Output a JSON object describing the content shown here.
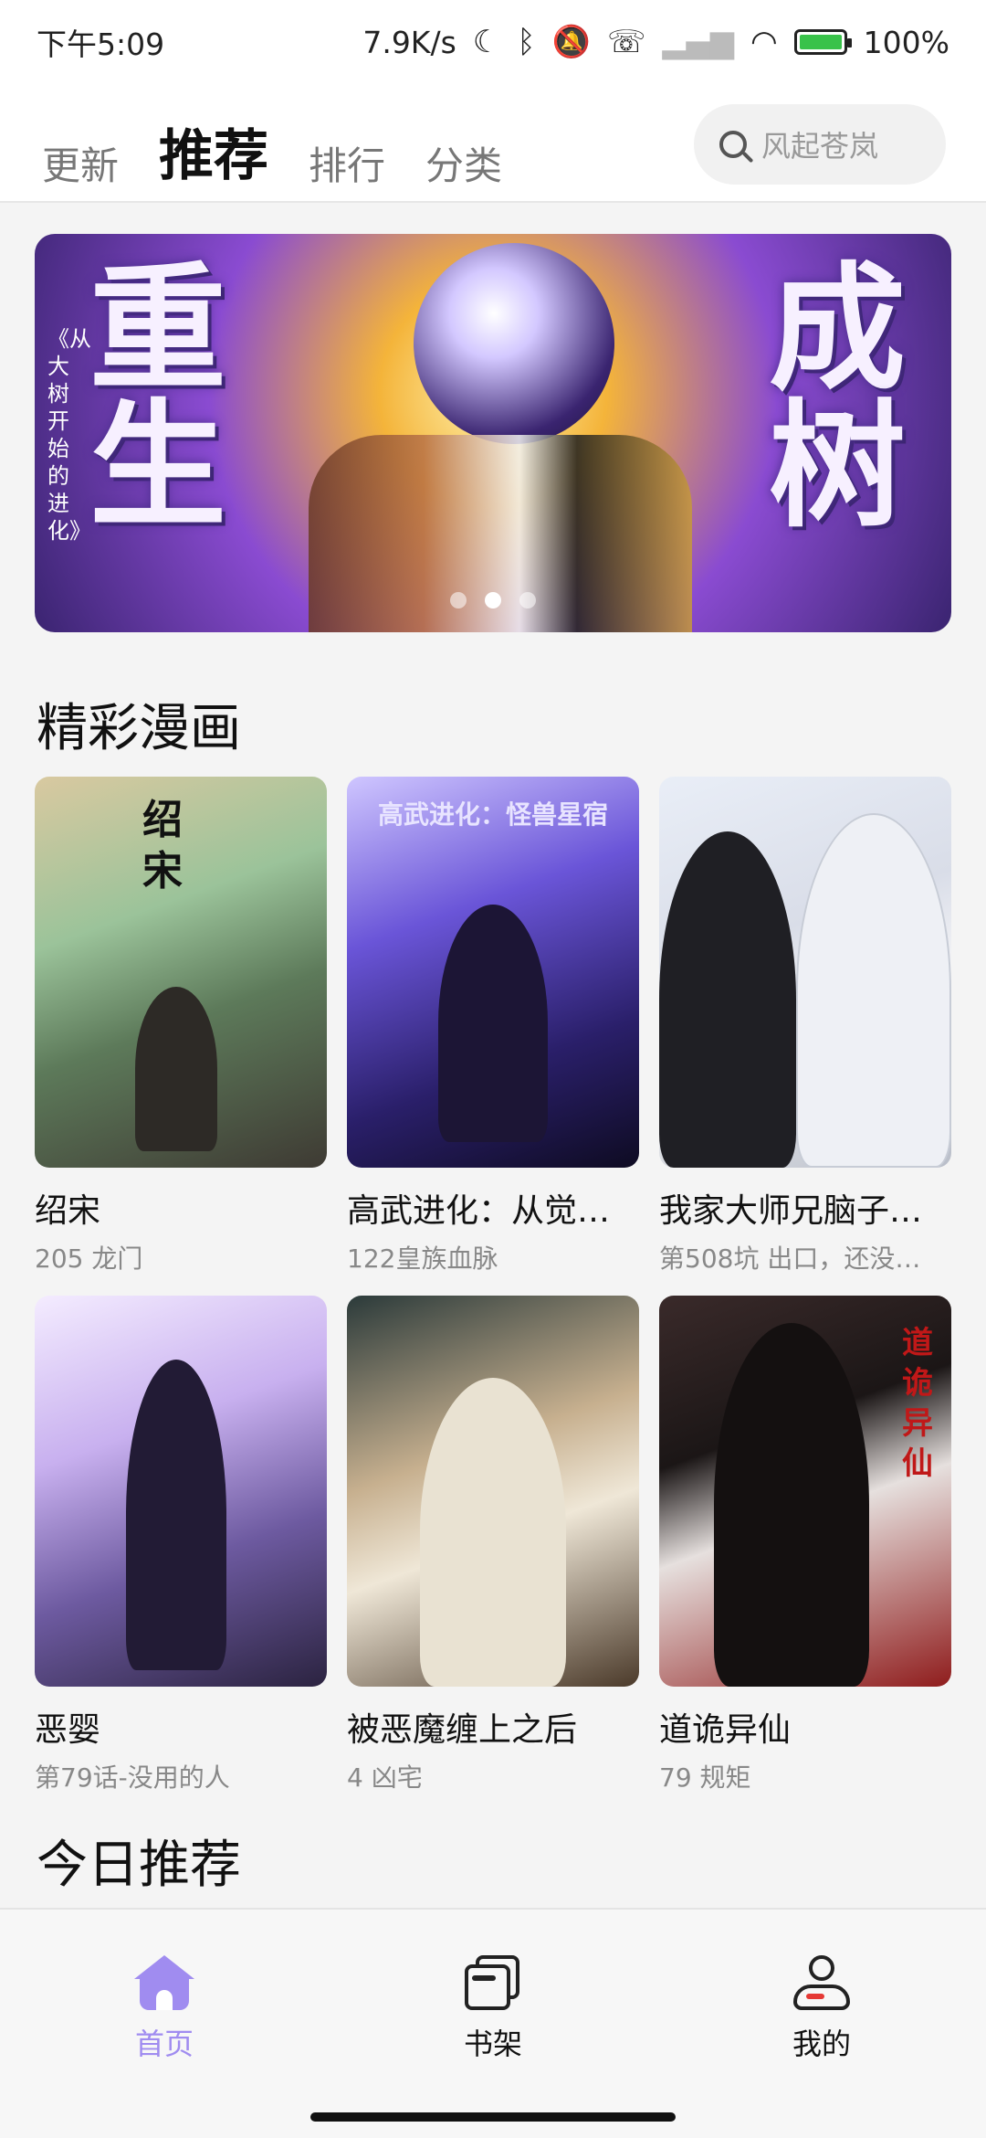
{
  "status_bar": {
    "time": "下午5:09",
    "speed": "7.9K/s",
    "battery": "100%",
    "icons": [
      "moon-icon",
      "bluetooth-icon",
      "mute-icon",
      "call-icon",
      "signal-icon",
      "wifi-icon",
      "battery-icon"
    ]
  },
  "header": {
    "tabs": [
      {
        "label": "更新",
        "active": false
      },
      {
        "label": "推荐",
        "active": true
      },
      {
        "label": "排行",
        "active": false
      },
      {
        "label": "分类",
        "active": false
      }
    ],
    "search_placeholder": "风起苍岚"
  },
  "banner": {
    "left_big": "重生",
    "right_big": "成树",
    "vertical_text": "《从大树开始的进化》",
    "dots": 3,
    "active_dot": 1
  },
  "section_featured": {
    "title": "精彩漫画",
    "items": [
      {
        "title": "绍宋",
        "subtitle": "205 龙门",
        "cover_mark": "绍宋"
      },
      {
        "title": "高武进化：从觉…",
        "subtitle": "122皇族血脉",
        "cover_mark": "高武进化：怪兽星宿"
      },
      {
        "title": "我家大师兄脑子…",
        "subtitle": "第508坑 出口，还没…",
        "cover_mark": ""
      },
      {
        "title": "恶婴",
        "subtitle": "第79话-没用的人",
        "cover_mark": ""
      },
      {
        "title": "被恶魔缠上之后",
        "subtitle": "4 凶宅",
        "cover_mark": ""
      },
      {
        "title": "道诡异仙",
        "subtitle": "79 规矩",
        "cover_mark": "道诡异仙"
      }
    ]
  },
  "section_today": {
    "title": "今日推荐"
  },
  "bottom_nav": {
    "items": [
      {
        "label": "首页",
        "icon": "home-icon",
        "active": true
      },
      {
        "label": "书架",
        "icon": "bookshelf-icon",
        "active": false
      },
      {
        "label": "我的",
        "icon": "user-icon",
        "active": false
      }
    ]
  },
  "colors": {
    "accent": "#a08cf0",
    "background": "#f4f4f4"
  }
}
